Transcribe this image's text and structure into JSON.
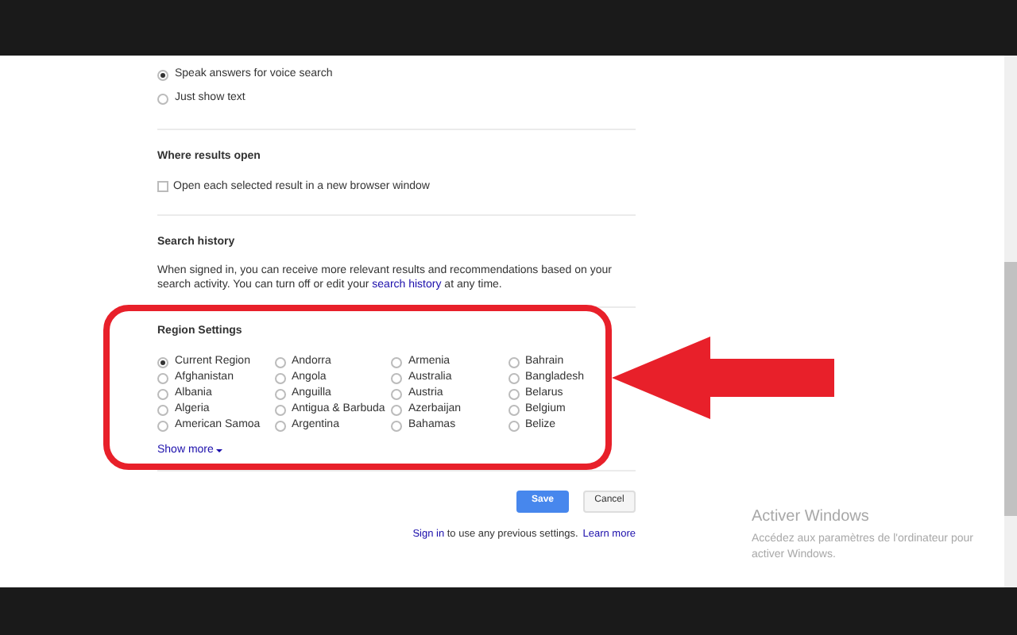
{
  "voice_options": [
    {
      "label": "Speak answers for voice search",
      "selected": true
    },
    {
      "label": "Just show text",
      "selected": false
    }
  ],
  "results_open": {
    "title": "Where results open",
    "checkbox": {
      "label": "Open each selected result in a new browser window",
      "checked": false
    }
  },
  "search_history": {
    "title": "Search history",
    "text_before": "When signed in, you can receive more relevant results and recommendations based on your search activity. You can turn off or edit your ",
    "link": "search history",
    "text_after": " at any time."
  },
  "region_settings": {
    "title": "Region Settings",
    "regions": [
      {
        "label": "Current Region",
        "selected": true
      },
      {
        "label": "Afghanistan",
        "selected": false
      },
      {
        "label": "Albania",
        "selected": false
      },
      {
        "label": "Algeria",
        "selected": false
      },
      {
        "label": "American Samoa",
        "selected": false
      },
      {
        "label": "Andorra",
        "selected": false
      },
      {
        "label": "Angola",
        "selected": false
      },
      {
        "label": "Anguilla",
        "selected": false
      },
      {
        "label": "Antigua & Barbuda",
        "selected": false
      },
      {
        "label": "Argentina",
        "selected": false
      },
      {
        "label": "Armenia",
        "selected": false
      },
      {
        "label": "Australia",
        "selected": false
      },
      {
        "label": "Austria",
        "selected": false
      },
      {
        "label": "Azerbaijan",
        "selected": false
      },
      {
        "label": "Bahamas",
        "selected": false
      },
      {
        "label": "Bahrain",
        "selected": false
      },
      {
        "label": "Bangladesh",
        "selected": false
      },
      {
        "label": "Belarus",
        "selected": false
      },
      {
        "label": "Belgium",
        "selected": false
      },
      {
        "label": "Belize",
        "selected": false
      }
    ],
    "show_more": "Show more"
  },
  "buttons": {
    "save": "Save",
    "cancel": "Cancel"
  },
  "sign_in": {
    "link": "Sign in",
    "text": " to use any previous settings.",
    "learn_more": "Learn more"
  },
  "activation_notice": {
    "title": "Activer Windows",
    "text": "Accédez aux paramètres de l'ordinateur pour activer Windows."
  }
}
